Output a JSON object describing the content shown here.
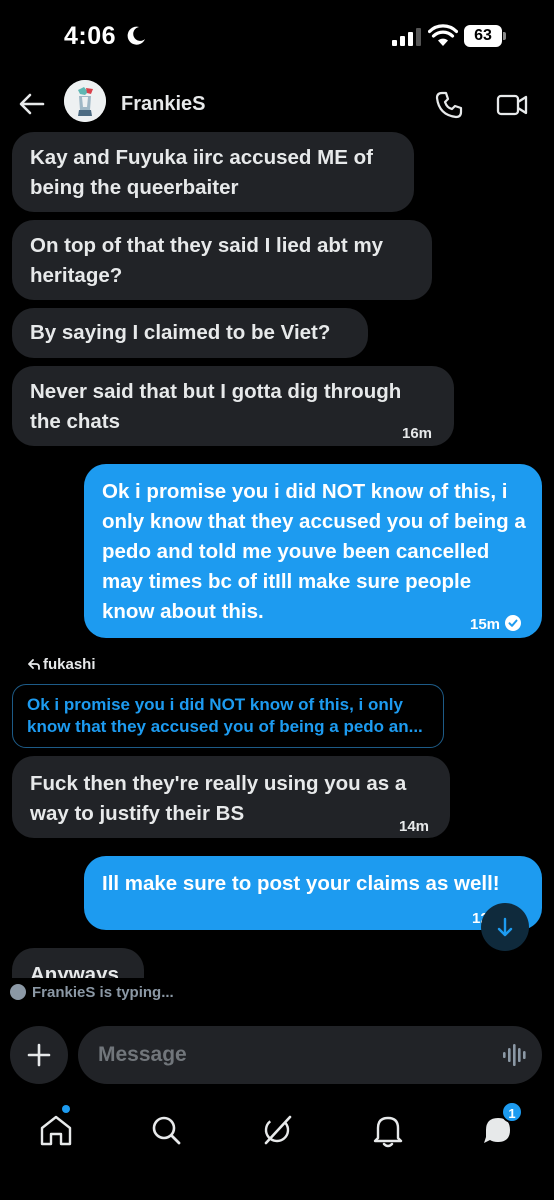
{
  "status_bar": {
    "time": "4:06",
    "battery": "63"
  },
  "header": {
    "contact_name": "FrankieS"
  },
  "messages": [
    {
      "dir": "in",
      "text": "Kay and Fuyuka iirc accused ME of being the queerbaiter"
    },
    {
      "dir": "in",
      "text": "On top of that they said I lied abt my heritage?"
    },
    {
      "dir": "in",
      "text": "By saying I claimed to be Viet?"
    },
    {
      "dir": "in",
      "text": "Never said that but I gotta dig through the chats",
      "time": "16m"
    },
    {
      "dir": "out",
      "text": "Ok i promise you i did NOT know of this, i only know that they accused you of being a pedo and told me youve been cancelled may times bc of itIll make sure people know about this.",
      "time": "15m"
    },
    {
      "dir": "in",
      "text": "Fuck then they're really using you as a way to justify their BS",
      "time": "14m"
    },
    {
      "dir": "out",
      "text": "Ill make sure to post your claims as well!",
      "time": "12"
    },
    {
      "dir": "in",
      "text": "Anyways"
    }
  ],
  "reply": {
    "label": "fukashi",
    "quote": "Ok i promise you i did NOT know of this, i only know that they accused you of being a pedo an..."
  },
  "typing": {
    "text": "FrankieS is typing..."
  },
  "composer": {
    "placeholder": "Message"
  },
  "tabbar": {
    "messages_badge": "1",
    "items": [
      "home-icon",
      "search-icon",
      "grok-icon",
      "notifications-icon",
      "messages-icon"
    ]
  },
  "colors": {
    "accent": "#1d9bf0",
    "incoming_bubble": "#212327",
    "background": "#000000"
  }
}
